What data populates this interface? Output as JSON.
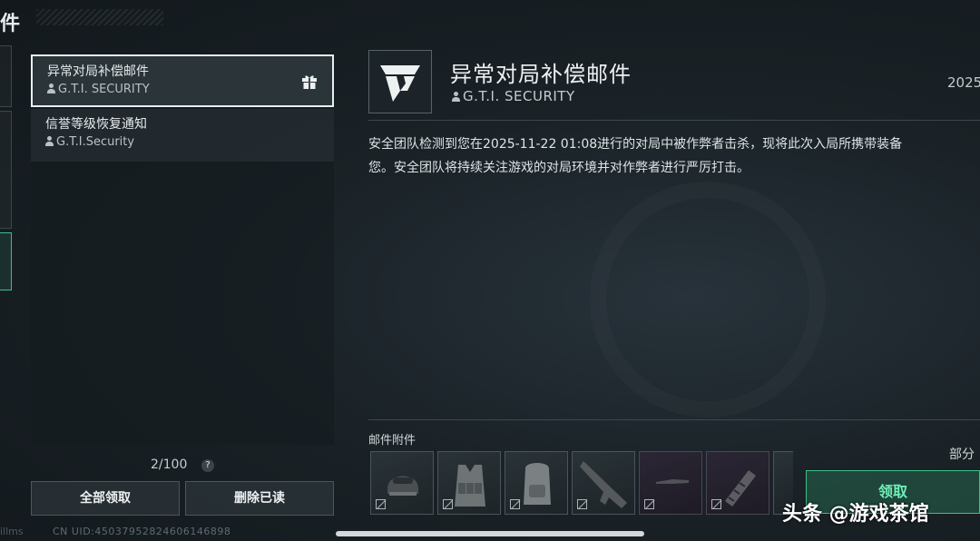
{
  "header": {
    "title": "件"
  },
  "mail_list": {
    "items": [
      {
        "title": "异常对局补偿邮件",
        "sender": "G.T.I. SECURITY",
        "selected": true,
        "icon": "gift-icon"
      },
      {
        "title": "信誉等级恢复通知",
        "sender": "G.T.I.Security",
        "selected": false
      }
    ],
    "count": "2/100",
    "help": "?",
    "claim_all_label": "全部领取",
    "delete_read_label": "删除已读"
  },
  "footer": {
    "uid": "CN UID:4503795282460614689​8",
    "left_fragment": "illms"
  },
  "detail": {
    "title": "异常对局补偿邮件",
    "sender": "G.T.I. SECURITY",
    "date": "2025",
    "body_lines": [
      "安全团队检测到您在2025-11-22 01:08进行的对局中被作弊者击杀，现将此次入局所携带装备",
      "您。安全团队将持续关注游戏的对局环境并对作弊者进行严厉打击。"
    ],
    "attachments_label": "邮件附件",
    "attachments": [
      {
        "icon": "helmet-icon",
        "rarity": "gray"
      },
      {
        "icon": "tactical-vest-icon",
        "rarity": "gray"
      },
      {
        "icon": "backpack-icon",
        "rarity": "gray"
      },
      {
        "icon": "rifle-icon",
        "rarity": "gray"
      },
      {
        "icon": "knife-icon",
        "rarity": "purple"
      },
      {
        "icon": "suppressor-icon",
        "rarity": "purple"
      }
    ],
    "partial_label": "部分",
    "claim_label": "领取"
  },
  "watermark": "头条 @游戏茶馆",
  "colors": {
    "accent": "#3fbf8a",
    "selected_border": "#e9eef0",
    "background": "#1a2227"
  }
}
